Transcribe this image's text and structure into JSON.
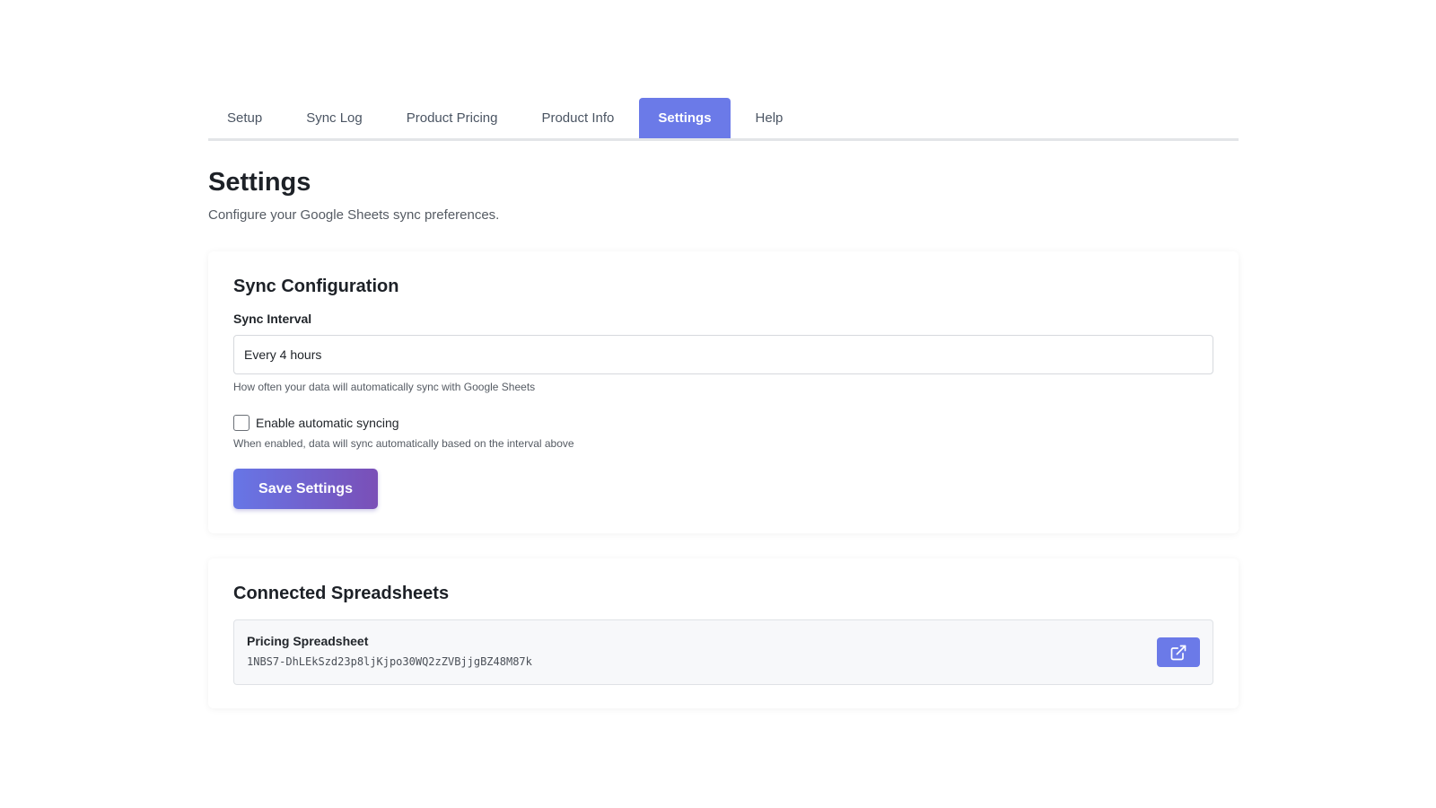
{
  "tabs": [
    {
      "label": "Setup"
    },
    {
      "label": "Sync Log"
    },
    {
      "label": "Product Pricing"
    },
    {
      "label": "Product Info"
    },
    {
      "label": "Settings",
      "active": true
    },
    {
      "label": "Help"
    }
  ],
  "page": {
    "title": "Settings",
    "subtitle": "Configure your Google Sheets sync preferences."
  },
  "sync_config": {
    "title": "Sync Configuration",
    "interval_label": "Sync Interval",
    "interval_value": "Every 4 hours",
    "interval_help": "How often your data will automatically sync with Google Sheets",
    "auto_sync_label": "Enable automatic syncing",
    "auto_sync_checked": false,
    "auto_sync_help": "When enabled, data will sync automatically based on the interval above",
    "save_label": "Save Settings"
  },
  "spreadsheets": {
    "title": "Connected Spreadsheets",
    "items": [
      {
        "name": "Pricing Spreadsheet",
        "id": "1NBS7-DhLEkSzd23p8ljKjpo30WQ2zZVBjjgBZ48M87k",
        "open_icon": "external-link-icon"
      }
    ]
  },
  "colors": {
    "accent": "#6b7ae8",
    "button_gradient_start": "#6776e6",
    "button_gradient_end": "#7a4fb7"
  }
}
